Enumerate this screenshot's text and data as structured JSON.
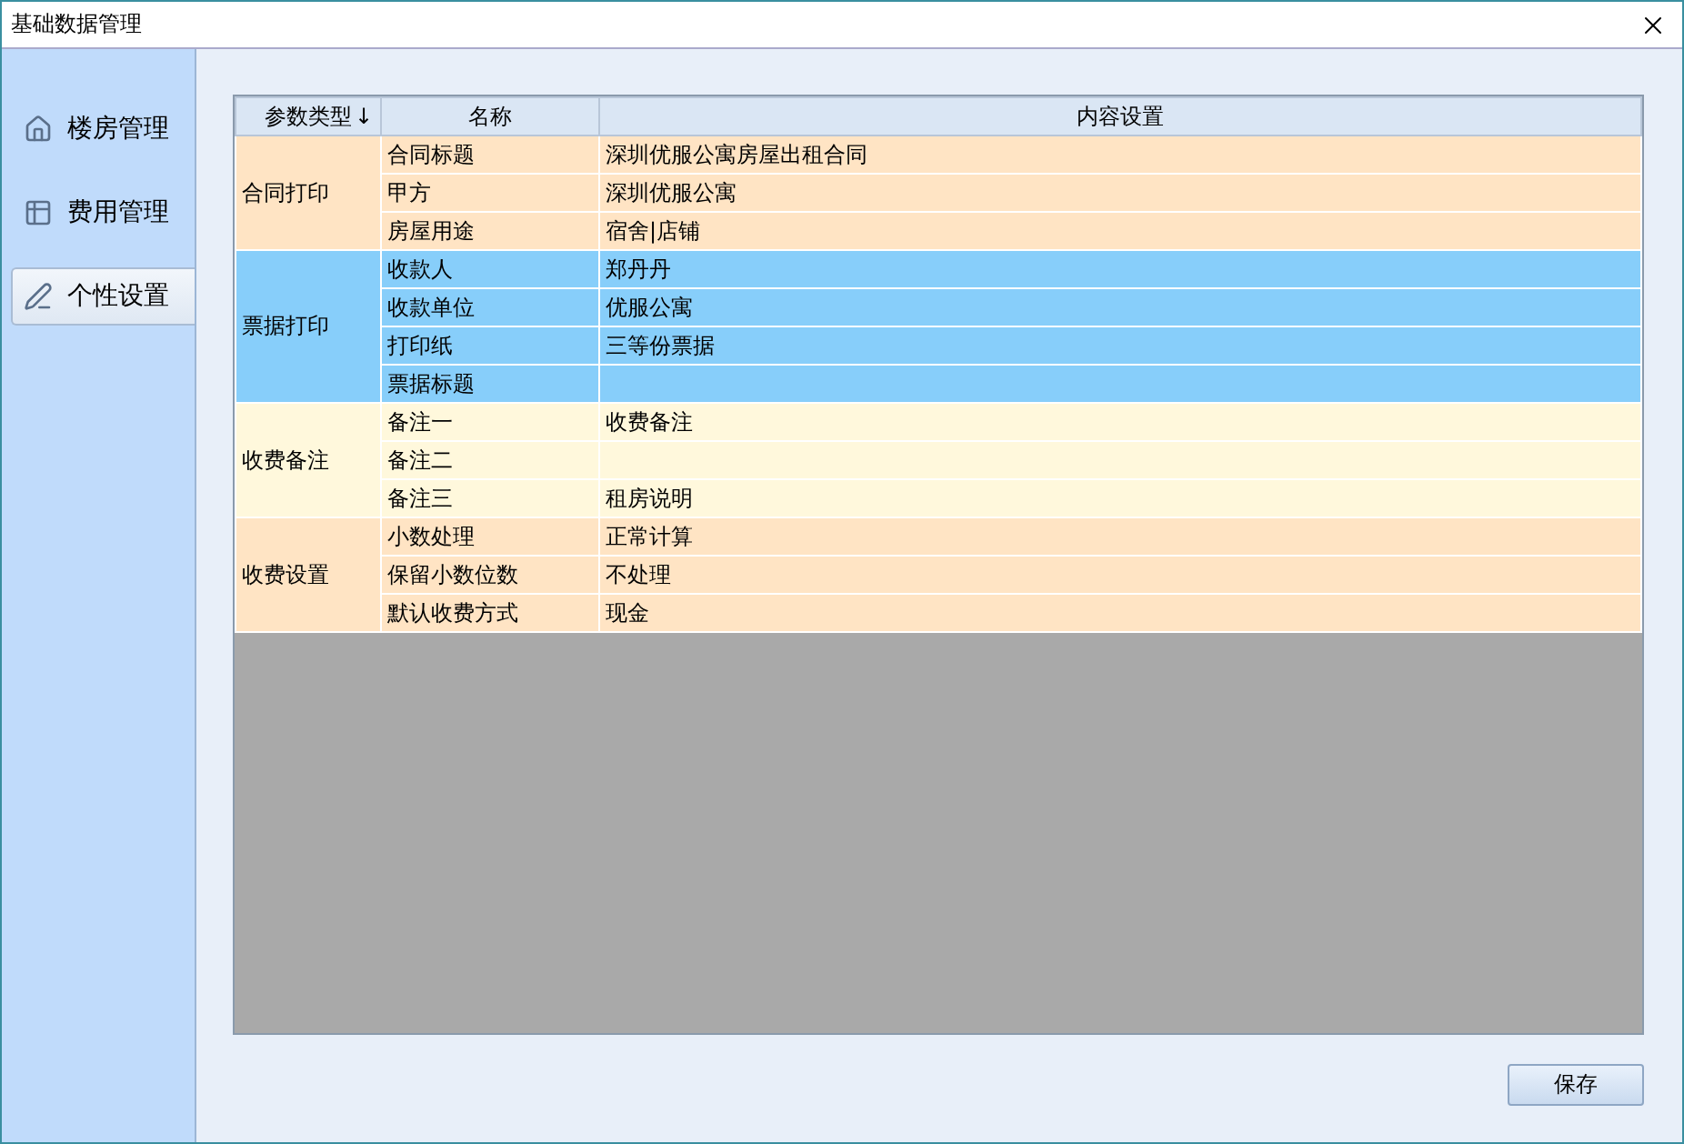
{
  "window": {
    "title": "基础数据管理"
  },
  "sidebar": {
    "items": [
      {
        "label": "楼房管理",
        "selected": false
      },
      {
        "label": "费用管理",
        "selected": false
      },
      {
        "label": "个性设置",
        "selected": true
      }
    ]
  },
  "table": {
    "columns": [
      {
        "label": "参数类型",
        "sort": "↓"
      },
      {
        "label": "名称"
      },
      {
        "label": "内容设置"
      }
    ],
    "groups": [
      {
        "label": "合同打印",
        "color": "#ffe4c4",
        "rows": [
          {
            "name": "合同标题",
            "value": "深圳优服公寓房屋出租合同"
          },
          {
            "name": "甲方",
            "value": "深圳优服公寓"
          },
          {
            "name": "房屋用途",
            "value": "宿舍|店铺"
          }
        ]
      },
      {
        "label": "票据打印",
        "color": "#87cefa",
        "rows": [
          {
            "name": "收款人",
            "value": "郑丹丹"
          },
          {
            "name": "收款单位",
            "value": "优服公寓"
          },
          {
            "name": "打印纸",
            "value": "三等份票据"
          },
          {
            "name": "票据标题"
          }
        ]
      },
      {
        "label": "收费备注",
        "color": "#fff8dc",
        "rows": [
          {
            "name": "备注一",
            "value": "收费备注"
          },
          {
            "name": "备注二"
          },
          {
            "name": "备注三",
            "value": "租房说明"
          }
        ]
      },
      {
        "label": "收费设置",
        "color": "#ffe4c4",
        "rows": [
          {
            "name": "小数处理",
            "value": "正常计算"
          },
          {
            "name": "保留小数位数",
            "value": "不处理"
          },
          {
            "name": "默认收费方式",
            "value": "现金"
          }
        ]
      }
    ]
  },
  "buttons": [
    "保存"
  ]
}
